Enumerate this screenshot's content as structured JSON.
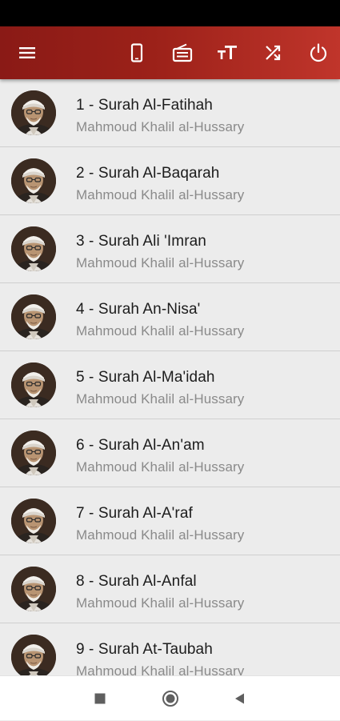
{
  "toolbar": {
    "menu_icon": "menu-icon",
    "actions": [
      {
        "name": "phone-icon"
      },
      {
        "name": "radio-icon"
      },
      {
        "name": "text-size-icon"
      },
      {
        "name": "shuffle-icon"
      },
      {
        "name": "power-icon"
      }
    ]
  },
  "colors": {
    "app_bar_start": "#8a1a16",
    "app_bar_end": "#c0352b",
    "list_background": "#ececec"
  },
  "surahs": [
    {
      "title": "1 - Surah Al-Fatihah",
      "reciter": "Mahmoud Khalil al-Hussary"
    },
    {
      "title": "2 - Surah Al-Baqarah",
      "reciter": "Mahmoud Khalil al-Hussary"
    },
    {
      "title": "3 - Surah Ali 'Imran",
      "reciter": "Mahmoud Khalil al-Hussary"
    },
    {
      "title": "4 - Surah An-Nisa'",
      "reciter": "Mahmoud Khalil al-Hussary"
    },
    {
      "title": "5 - Surah Al-Ma'idah",
      "reciter": "Mahmoud Khalil al-Hussary"
    },
    {
      "title": "6 - Surah Al-An'am",
      "reciter": "Mahmoud Khalil al-Hussary"
    },
    {
      "title": "7 - Surah Al-A'raf",
      "reciter": "Mahmoud Khalil al-Hussary"
    },
    {
      "title": "8 - Surah Al-Anfal",
      "reciter": "Mahmoud Khalil al-Hussary"
    },
    {
      "title": "9 - Surah At-Taubah",
      "reciter": "Mahmoud Khalil al-Hussary"
    }
  ],
  "system_nav": {
    "recents": "square-icon",
    "home": "circle-icon",
    "back": "triangle-back-icon"
  }
}
